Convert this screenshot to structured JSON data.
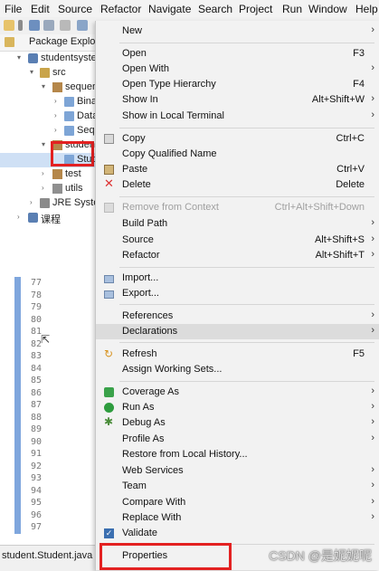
{
  "menubar": [
    "File",
    "Edit",
    "Source",
    "Refactor",
    "Navigate",
    "Search",
    "Project",
    "Run",
    "Window",
    "Help"
  ],
  "explorer": {
    "title": "Package Explorer",
    "rows": [
      {
        "label": "studentsystem"
      },
      {
        "label": "src"
      },
      {
        "label": "sequence"
      },
      {
        "label": "Binary..."
      },
      {
        "label": "Data..."
      },
      {
        "label": "Seq..."
      },
      {
        "label": "student"
      },
      {
        "label": "Stud..."
      },
      {
        "label": "test"
      },
      {
        "label": "utils"
      },
      {
        "label": "JRE System Library"
      },
      {
        "label": "课程"
      }
    ]
  },
  "editor": {
    "line_numbers": [
      "77",
      "78",
      "79",
      "80",
      "81",
      "82",
      "83",
      "84",
      "85",
      "86",
      "87",
      "88",
      "89",
      "90",
      "91",
      "92",
      "93",
      "94",
      "95",
      "96",
      "97"
    ]
  },
  "bottom_tab": "student.Student.java",
  "menu": {
    "items": [
      {
        "label": "New",
        "shortcut": "",
        "submenu": true
      },
      {
        "label": "Open",
        "shortcut": "F3"
      },
      {
        "label": "Open With",
        "shortcut": "",
        "submenu": true
      },
      {
        "label": "Open Type Hierarchy",
        "shortcut": "F4"
      },
      {
        "label": "Show In",
        "shortcut": "Alt+Shift+W",
        "submenu": true
      },
      {
        "label": "Show in Local Terminal",
        "shortcut": "",
        "submenu": true
      },
      {
        "label": "Copy",
        "shortcut": "Ctrl+C",
        "icon": "copy-icon"
      },
      {
        "label": "Copy Qualified Name",
        "shortcut": ""
      },
      {
        "label": "Paste",
        "shortcut": "Ctrl+V",
        "icon": "paste-icon"
      },
      {
        "label": "Delete",
        "shortcut": "Delete",
        "icon": "delete-icon"
      },
      {
        "label": "Remove from Context",
        "shortcut": "Ctrl+Alt+Shift+Down",
        "disabled": true,
        "icon": "remove-context-icon"
      },
      {
        "label": "Build Path",
        "shortcut": "",
        "submenu": true
      },
      {
        "label": "Source",
        "shortcut": "Alt+Shift+S",
        "submenu": true
      },
      {
        "label": "Refactor",
        "shortcut": "Alt+Shift+T",
        "submenu": true
      },
      {
        "label": "Import...",
        "shortcut": "",
        "icon": "import-icon"
      },
      {
        "label": "Export...",
        "shortcut": "",
        "icon": "export-icon"
      },
      {
        "label": "References",
        "shortcut": "",
        "submenu": true
      },
      {
        "label": "Declarations",
        "shortcut": "",
        "submenu": true,
        "highlighted": true
      },
      {
        "label": "Refresh",
        "shortcut": "F5",
        "icon": "refresh-icon"
      },
      {
        "label": "Assign Working Sets...",
        "shortcut": ""
      },
      {
        "label": "Coverage As",
        "shortcut": "",
        "submenu": true,
        "icon": "coverage-icon"
      },
      {
        "label": "Run As",
        "shortcut": "",
        "submenu": true,
        "icon": "run-icon"
      },
      {
        "label": "Debug As",
        "shortcut": "",
        "submenu": true,
        "icon": "debug-icon"
      },
      {
        "label": "Profile As",
        "shortcut": "",
        "submenu": true
      },
      {
        "label": "Restore from Local History...",
        "shortcut": ""
      },
      {
        "label": "Web Services",
        "shortcut": "",
        "submenu": true
      },
      {
        "label": "Team",
        "shortcut": "",
        "submenu": true
      },
      {
        "label": "Compare With",
        "shortcut": "",
        "submenu": true
      },
      {
        "label": "Replace With",
        "shortcut": "",
        "submenu": true
      },
      {
        "label": "Validate",
        "shortcut": "",
        "icon": "validate-check-icon"
      },
      {
        "label": "Properties",
        "shortcut": ""
      }
    ]
  },
  "watermark": "CSDN @是妮妮呢",
  "colors": {
    "highlight_box": "#e32121",
    "ruler": "#7fa6dd",
    "menu_bg": "#f2f2f2"
  }
}
